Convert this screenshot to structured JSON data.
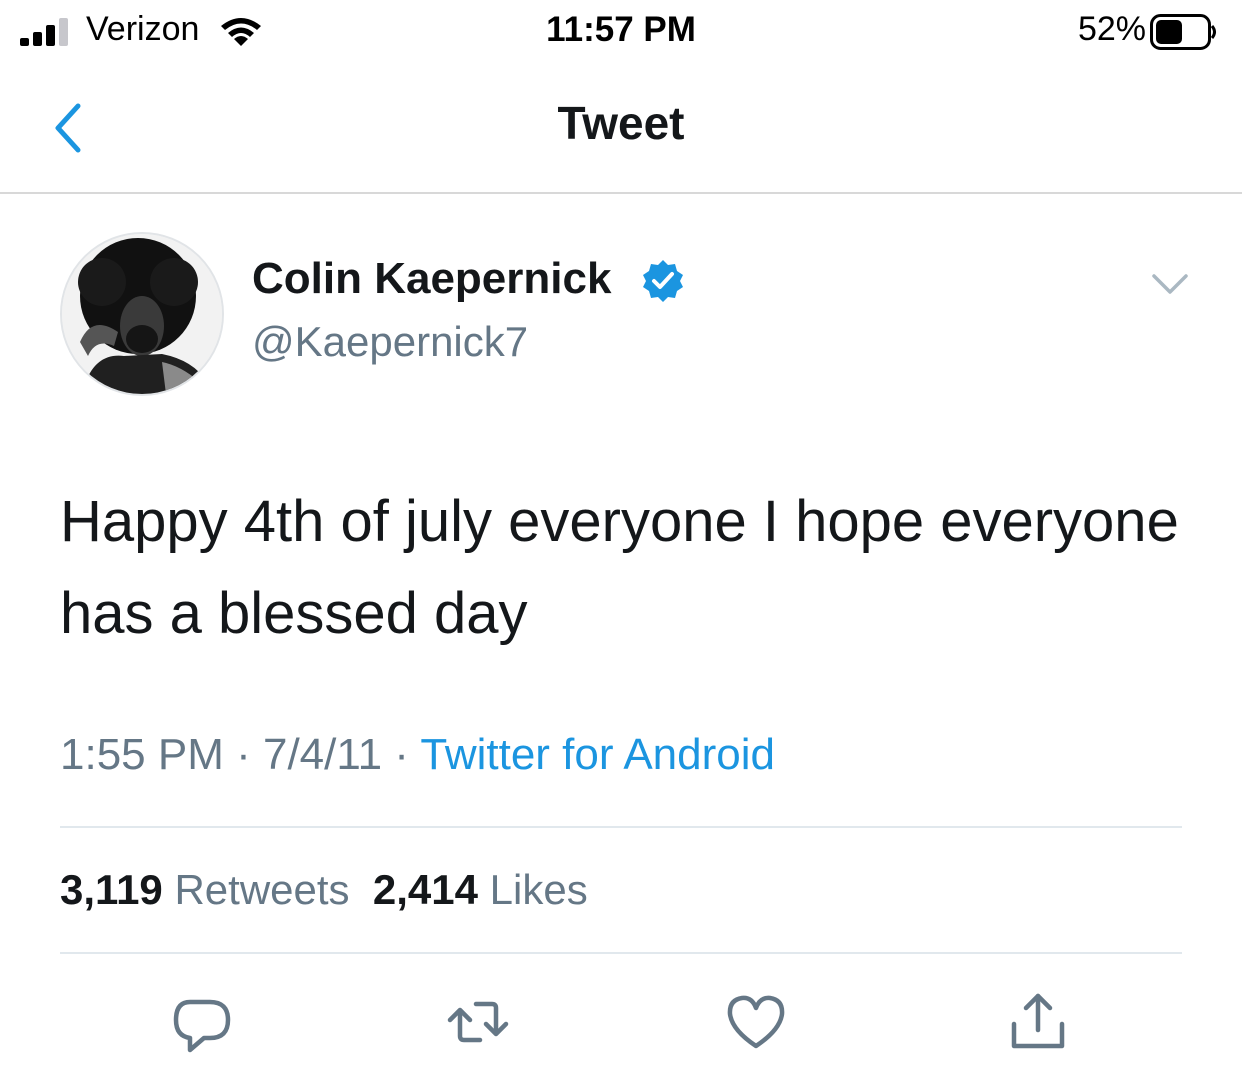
{
  "status_bar": {
    "carrier": "Verizon",
    "time": "11:57 PM",
    "battery_percent": "52%",
    "battery_level": 0.52,
    "signal_bars": 3
  },
  "nav": {
    "title": "Tweet"
  },
  "tweet": {
    "display_name": "Colin Kaepernick",
    "handle": "@Kaepernick7",
    "verified": true,
    "text": "Happy 4th of july everyone I hope everyone has a blessed day",
    "time": "1:55 PM",
    "separator": " · ",
    "date": "7/4/11",
    "source": "Twitter for Android",
    "retweets_count": "3,119",
    "retweets_label": "Retweets",
    "likes_count": "2,414",
    "likes_label": "Likes"
  },
  "colors": {
    "accent": "#1b95e0",
    "text_primary": "#14171a",
    "text_secondary": "#657786",
    "divider": "#e1e8ed",
    "icon_gray": "#657786"
  },
  "icons": {
    "back": "chevron-left-icon",
    "verified": "verified-badge-icon",
    "more": "chevron-down-icon",
    "reply": "reply-icon",
    "retweet": "retweet-icon",
    "like": "heart-icon",
    "share": "share-icon"
  }
}
